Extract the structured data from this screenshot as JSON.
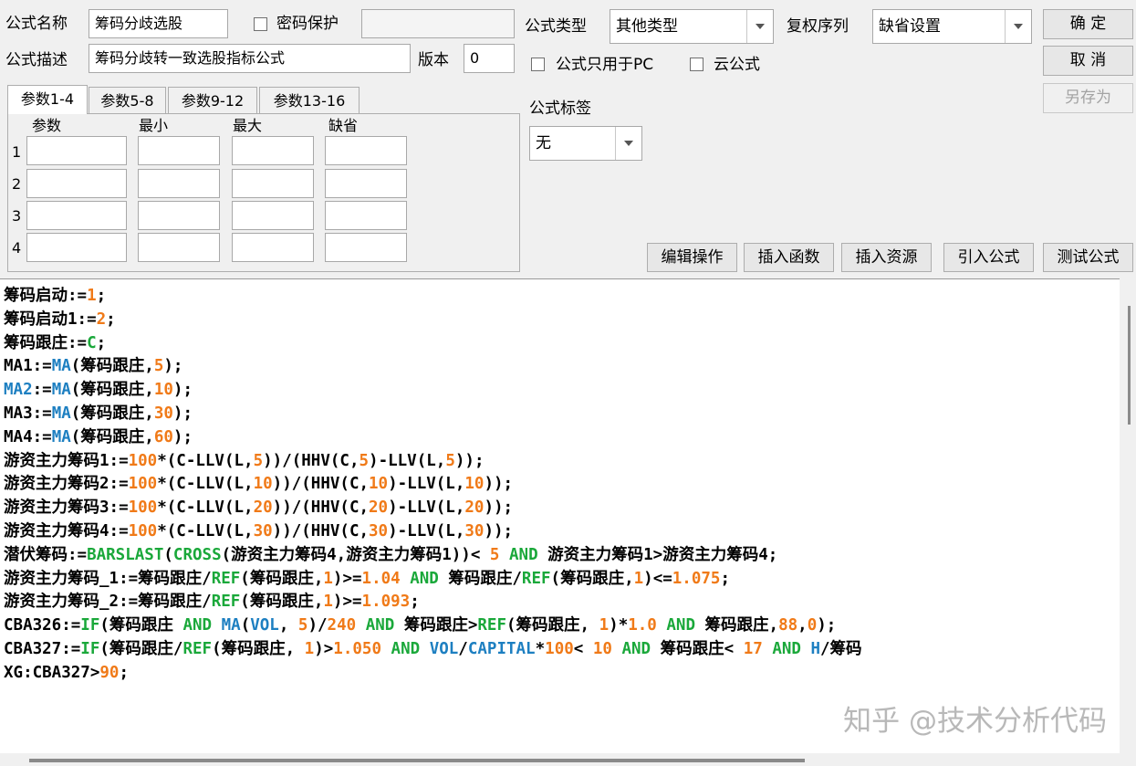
{
  "header": {
    "name_label": "公式名称",
    "name_value": "筹码分歧选股",
    "password_label": "密码保护",
    "password_value": "",
    "type_label": "公式类型",
    "type_value": "其他类型",
    "rights_label": "复权序列",
    "rights_value": "缺省设置",
    "desc_label": "公式描述",
    "desc_value": "筹码分歧转一致选股指标公式",
    "version_label": "版本",
    "version_value": "0",
    "pc_only_label": "公式只用于PC",
    "cloud_label": "云公式",
    "tag_label": "公式标签",
    "tag_value": "无"
  },
  "buttons": {
    "ok": "确  定",
    "cancel": "取  消",
    "save_as": "另存为",
    "edit_ops": "编辑操作",
    "insert_func": "插入函数",
    "insert_res": "插入资源",
    "import_formula": "引入公式",
    "test_formula": "测试公式"
  },
  "param_tabs": [
    {
      "label": "参数1-4"
    },
    {
      "label": "参数5-8"
    },
    {
      "label": "参数9-12"
    },
    {
      "label": "参数13-16"
    }
  ],
  "param_headers": {
    "param": "参数",
    "min": "最小",
    "max": "最大",
    "default": "缺省"
  },
  "param_rows": [
    {
      "num": "1"
    },
    {
      "num": "2"
    },
    {
      "num": "3"
    },
    {
      "num": "4"
    }
  ],
  "code_lines": [
    [
      [
        "筹码启动",
        "k"
      ],
      [
        ":=",
        "k"
      ],
      [
        "1",
        "n"
      ],
      [
        ";",
        "k"
      ]
    ],
    [
      [
        "筹码启动",
        "k"
      ],
      [
        "1:=",
        "k"
      ],
      [
        "2",
        "n"
      ],
      [
        ";",
        "k"
      ]
    ],
    [
      [
        "筹码跟庄",
        "k"
      ],
      [
        ":=",
        "k"
      ],
      [
        "C",
        "c"
      ],
      [
        ";",
        "k"
      ]
    ],
    [
      [
        "MA1:=",
        "k"
      ],
      [
        "MA",
        "f"
      ],
      [
        "(筹码跟庄,",
        "k"
      ],
      [
        "5",
        "n"
      ],
      [
        ");",
        "k"
      ]
    ],
    [
      [
        "MA2",
        "f"
      ],
      [
        ":=",
        "k"
      ],
      [
        "MA",
        "f"
      ],
      [
        "(筹码跟庄,",
        "k"
      ],
      [
        "10",
        "n"
      ],
      [
        ");",
        "k"
      ]
    ],
    [
      [
        "MA3:=",
        "k"
      ],
      [
        "MA",
        "f"
      ],
      [
        "(筹码跟庄,",
        "k"
      ],
      [
        "30",
        "n"
      ],
      [
        ");",
        "k"
      ]
    ],
    [
      [
        "MA4:=",
        "k"
      ],
      [
        "MA",
        "f"
      ],
      [
        "(筹码跟庄,",
        "k"
      ],
      [
        "60",
        "n"
      ],
      [
        ");",
        "k"
      ]
    ],
    [
      [
        "游资主力筹码1:=",
        "k"
      ],
      [
        "100",
        "n"
      ],
      [
        "*(C-LLV(L,",
        "k"
      ],
      [
        "5",
        "n"
      ],
      [
        "))/(HHV(C,",
        "k"
      ],
      [
        "5",
        "n"
      ],
      [
        ")-LLV(L,",
        "k"
      ],
      [
        "5",
        "n"
      ],
      [
        "));",
        "k"
      ]
    ],
    [
      [
        "游资主力筹码2:=",
        "k"
      ],
      [
        "100",
        "n"
      ],
      [
        "*(C-LLV(L,",
        "k"
      ],
      [
        "10",
        "n"
      ],
      [
        "))/(HHV(C,",
        "k"
      ],
      [
        "10",
        "n"
      ],
      [
        ")-LLV(L,",
        "k"
      ],
      [
        "10",
        "n"
      ],
      [
        "));",
        "k"
      ]
    ],
    [
      [
        "游资主力筹码3:=",
        "k"
      ],
      [
        "100",
        "n"
      ],
      [
        "*(C-LLV(L,",
        "k"
      ],
      [
        "20",
        "n"
      ],
      [
        "))/(HHV(C,",
        "k"
      ],
      [
        "20",
        "n"
      ],
      [
        ")-LLV(L,",
        "k"
      ],
      [
        "20",
        "n"
      ],
      [
        "));",
        "k"
      ]
    ],
    [
      [
        "游资主力筹码4:=",
        "k"
      ],
      [
        "100",
        "n"
      ],
      [
        "*(C-LLV(L,",
        "k"
      ],
      [
        "30",
        "n"
      ],
      [
        "))/(HHV(C,",
        "k"
      ],
      [
        "30",
        "n"
      ],
      [
        ")-LLV(L,",
        "k"
      ],
      [
        "30",
        "n"
      ],
      [
        "));",
        "k"
      ]
    ],
    [
      [
        "潜伏筹码:=",
        "k"
      ],
      [
        "BARSLAST",
        "c"
      ],
      [
        "(",
        "k"
      ],
      [
        "CROSS",
        "c"
      ],
      [
        "(游资主力筹码4,游资主力筹码1))< ",
        "k"
      ],
      [
        "5",
        "n"
      ],
      [
        " ",
        "k"
      ],
      [
        "AND",
        "c"
      ],
      [
        " 游资主力筹码1>游资主力筹码4;",
        "k"
      ]
    ],
    [
      [
        "游资主力筹码_1:=筹码跟庄/",
        "k"
      ],
      [
        "REF",
        "c"
      ],
      [
        "(筹码跟庄,",
        "k"
      ],
      [
        "1",
        "n"
      ],
      [
        ")>=",
        "k"
      ],
      [
        "1.04",
        "n"
      ],
      [
        " ",
        "k"
      ],
      [
        "AND",
        "c"
      ],
      [
        " 筹码跟庄/",
        "k"
      ],
      [
        "REF",
        "c"
      ],
      [
        "(筹码跟庄,",
        "k"
      ],
      [
        "1",
        "n"
      ],
      [
        ")<=",
        "k"
      ],
      [
        "1.075",
        "n"
      ],
      [
        ";",
        "k"
      ]
    ],
    [
      [
        "游资主力筹码_2:=筹码跟庄/",
        "k"
      ],
      [
        "REF",
        "c"
      ],
      [
        "(筹码跟庄,",
        "k"
      ],
      [
        "1",
        "n"
      ],
      [
        ")>=",
        "k"
      ],
      [
        "1.093",
        "n"
      ],
      [
        ";",
        "k"
      ]
    ],
    [
      [
        "CBA326:=",
        "k"
      ],
      [
        "IF",
        "c"
      ],
      [
        "(筹码跟庄 ",
        "k"
      ],
      [
        "AND",
        "c"
      ],
      [
        " ",
        "k"
      ],
      [
        "MA",
        "f"
      ],
      [
        "(",
        "k"
      ],
      [
        "VOL",
        "f"
      ],
      [
        ", ",
        "k"
      ],
      [
        "5",
        "n"
      ],
      [
        ")/",
        "k"
      ],
      [
        "240",
        "n"
      ],
      [
        " ",
        "k"
      ],
      [
        "AND",
        "c"
      ],
      [
        " 筹码跟庄>",
        "k"
      ],
      [
        "REF",
        "c"
      ],
      [
        "(筹码跟庄, ",
        "k"
      ],
      [
        "1",
        "n"
      ],
      [
        ")*",
        "k"
      ],
      [
        "1.0",
        "n"
      ],
      [
        " ",
        "k"
      ],
      [
        "AND",
        "c"
      ],
      [
        " 筹码跟庄,",
        "k"
      ],
      [
        "88",
        "n"
      ],
      [
        ",",
        "k"
      ],
      [
        "0",
        "n"
      ],
      [
        ");",
        "k"
      ]
    ],
    [
      [
        "CBA327:=",
        "k"
      ],
      [
        "IF",
        "c"
      ],
      [
        "(筹码跟庄/",
        "k"
      ],
      [
        "REF",
        "c"
      ],
      [
        "(筹码跟庄, ",
        "k"
      ],
      [
        "1",
        "n"
      ],
      [
        ")>",
        "k"
      ],
      [
        "1.050",
        "n"
      ],
      [
        " ",
        "k"
      ],
      [
        "AND",
        "c"
      ],
      [
        " ",
        "k"
      ],
      [
        "VOL",
        "f"
      ],
      [
        "/",
        "k"
      ],
      [
        "CAPITAL",
        "f"
      ],
      [
        "*",
        "k"
      ],
      [
        "100",
        "n"
      ],
      [
        "< ",
        "k"
      ],
      [
        "10",
        "n"
      ],
      [
        " ",
        "k"
      ],
      [
        "AND",
        "c"
      ],
      [
        " 筹码跟庄< ",
        "k"
      ],
      [
        "17",
        "n"
      ],
      [
        " ",
        "k"
      ],
      [
        "AND",
        "c"
      ],
      [
        " ",
        "k"
      ],
      [
        "H",
        "f"
      ],
      [
        "/筹码",
        "k"
      ]
    ],
    [
      [
        "XG:CBA327>",
        "k"
      ],
      [
        "90",
        "n"
      ],
      [
        ";",
        "k"
      ]
    ]
  ],
  "watermark": "知乎 @技术分析代码",
  "colors": {
    "keyword": "#1aa83a",
    "function": "#1d7fc1",
    "number": "#f07a18",
    "text": "#000000"
  }
}
